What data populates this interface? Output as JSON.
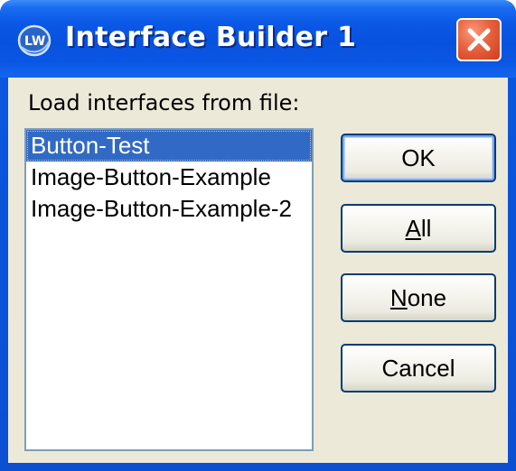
{
  "window": {
    "title": "Interface Builder 1",
    "icon": "lw-app-icon",
    "close_icon": "close-icon"
  },
  "dialog": {
    "label": "Load interfaces from file:",
    "list_items": [
      {
        "label": "Button-Test",
        "selected": true
      },
      {
        "label": "Image-Button-Example",
        "selected": false
      },
      {
        "label": "Image-Button-Example-2",
        "selected": false
      }
    ],
    "buttons": {
      "ok": "OK",
      "all_mnemonic": "A",
      "all_rest": "ll",
      "none_mnemonic": "N",
      "none_rest": "one",
      "cancel": "Cancel"
    }
  },
  "colors": {
    "titlebar": "#0a58e6",
    "client_bg": "#ece9d8",
    "selection": "#316ac5",
    "close_button": "#e8623f"
  }
}
